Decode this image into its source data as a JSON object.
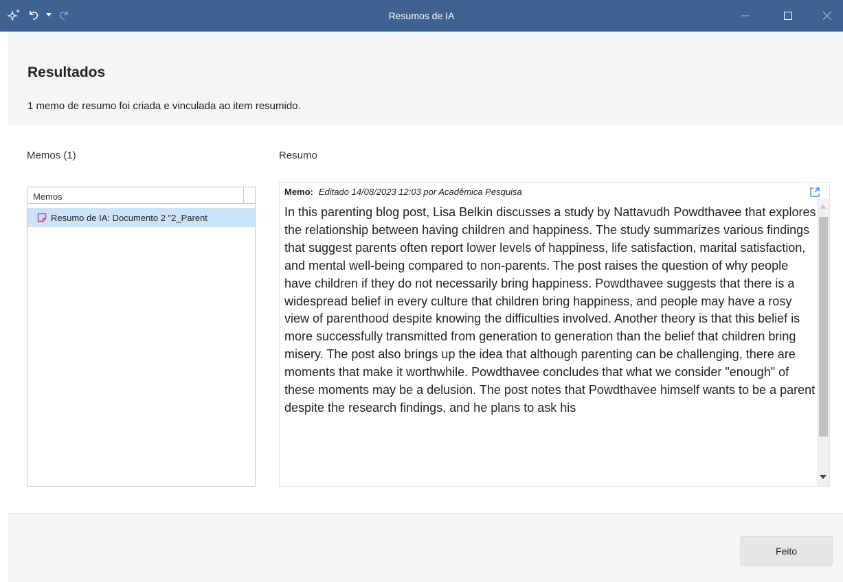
{
  "window": {
    "title": "Resumos de IA"
  },
  "header": {
    "title": "Resultados",
    "subtitle": "1 memo de resumo foi criada e vinculada ao item resumido."
  },
  "memos_panel": {
    "label": "Memos (1)",
    "column_header": "Memos",
    "items": [
      {
        "label": "Resumo de IA: Documento 2 \"2_Parent"
      }
    ]
  },
  "summary_panel": {
    "label": "Resumo",
    "meta_label": "Memo:",
    "meta_value": "Editado 14/08/2023 12:03 por Acadêmica Pesquisa",
    "text": "In this parenting blog post, Lisa Belkin discusses a study by Nattavudh Powdthavee that explores the relationship between having children and happiness. The study summarizes various findings that suggest parents often report lower levels of happiness, life satisfaction, marital satisfaction, and mental well-being compared to non-parents. The post raises the question of why people have children if they do not necessarily bring happiness. Powdthavee suggests that there is a widespread belief in every culture that children bring happiness, and people may have a rosy view of parenthood despite knowing the difficulties involved. Another theory is that this belief is more successfully transmitted from generation to generation than the belief that children bring misery. The post also brings up the idea that although parenting can be challenging, there are moments that make it worthwhile. Powdthavee concludes that what we consider \"enough\" of these moments may be a delusion. The post notes that Powdthavee himself wants to be a parent despite the research findings, and he plans to ask his"
  },
  "footer": {
    "done_label": "Feito"
  },
  "colors": {
    "titlebar": "#3e6390",
    "selection": "#cce4f7",
    "memo_icon": "#e0308a",
    "panel_bg": "#f5f5f5"
  },
  "icons": [
    "ai-sparkle-icon",
    "undo-icon",
    "undo-dropdown-icon",
    "redo-icon",
    "minimize-icon",
    "maximize-icon",
    "close-icon",
    "memo-icon",
    "open-external-icon"
  ]
}
